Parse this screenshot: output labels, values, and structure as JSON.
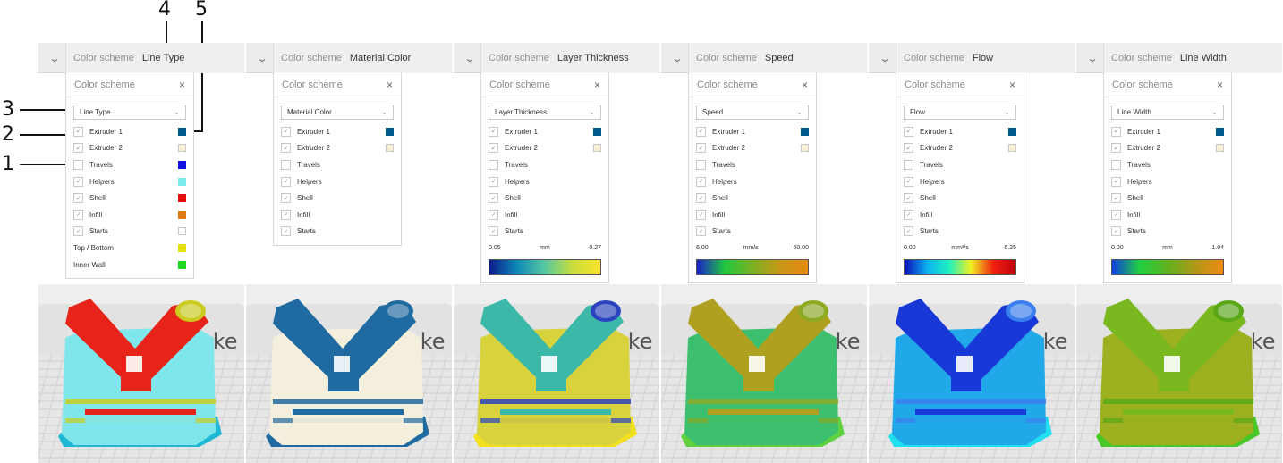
{
  "callouts": [
    {
      "label": "4"
    },
    {
      "label": "5"
    },
    {
      "label": "3"
    },
    {
      "label": "2"
    },
    {
      "label": "1"
    }
  ],
  "panels": [
    {
      "bar_label": "Color scheme",
      "bar_value": "Line Type",
      "box_title": "Color scheme",
      "close": "×",
      "select": "Line Type",
      "rows": [
        {
          "label": "Extruder 1",
          "checked": true,
          "has_box": true,
          "color": "#005b8c"
        },
        {
          "label": "Extruder 2",
          "checked": true,
          "has_box": true,
          "color": "#f6efd4"
        },
        {
          "label": "Travels",
          "checked": false,
          "has_box": true,
          "color": "#1010e0"
        },
        {
          "label": "Helpers",
          "checked": true,
          "has_box": true,
          "color": "#7aecef"
        },
        {
          "label": "Shell",
          "checked": true,
          "has_box": true,
          "color": "#e01010"
        },
        {
          "label": "Infill",
          "checked": true,
          "has_box": true,
          "color": "#e07a10"
        },
        {
          "label": "Starts",
          "checked": true,
          "has_box": true,
          "color": "#ffffff"
        },
        {
          "label": "Top / Bottom",
          "checked": false,
          "has_box": false,
          "color": "#e6e010"
        },
        {
          "label": "Inner Wall",
          "checked": false,
          "has_box": false,
          "color": "#20d820"
        }
      ],
      "legend": null,
      "model": {
        "primary": "#e8231a",
        "secondary": "#7fe6ec",
        "accent": "#cccc20",
        "base": "#21b8d6"
      }
    },
    {
      "bar_label": "Color scheme",
      "bar_value": "Material Color",
      "box_title": "Color scheme",
      "close": "×",
      "select": "Material Color",
      "rows": [
        {
          "label": "Extruder 1",
          "checked": true,
          "has_box": true,
          "color": "#005b8c"
        },
        {
          "label": "Extruder 2",
          "checked": true,
          "has_box": true,
          "color": "#f6efd4"
        },
        {
          "label": "Travels",
          "checked": false,
          "has_box": true,
          "color": null
        },
        {
          "label": "Helpers",
          "checked": true,
          "has_box": true,
          "color": null
        },
        {
          "label": "Shell",
          "checked": true,
          "has_box": true,
          "color": null
        },
        {
          "label": "Infill",
          "checked": true,
          "has_box": true,
          "color": null
        },
        {
          "label": "Starts",
          "checked": true,
          "has_box": true,
          "color": null
        }
      ],
      "legend": null,
      "model": {
        "primary": "#1f6aa0",
        "secondary": "#f4efdc",
        "accent": "#1f6aa0",
        "base": "#1f6aa0"
      }
    },
    {
      "bar_label": "Color scheme",
      "bar_value": "Layer Thickness",
      "box_title": "Color scheme",
      "close": "×",
      "select": "Layer Thickness",
      "rows": [
        {
          "label": "Extruder 1",
          "checked": true,
          "has_box": true,
          "color": "#005b8c"
        },
        {
          "label": "Extruder 2",
          "checked": true,
          "has_box": true,
          "color": "#f6efd4"
        },
        {
          "label": "Travels",
          "checked": false,
          "has_box": true,
          "color": null
        },
        {
          "label": "Helpers",
          "checked": true,
          "has_box": true,
          "color": null
        },
        {
          "label": "Shell",
          "checked": true,
          "has_box": true,
          "color": null
        },
        {
          "label": "Infill",
          "checked": true,
          "has_box": true,
          "color": null
        },
        {
          "label": "Starts",
          "checked": true,
          "has_box": true,
          "color": null
        }
      ],
      "legend": {
        "min": "0.05",
        "unit": "mm",
        "max": "0.27",
        "gradient": [
          "#0c1a8c",
          "#0e8ab8",
          "#57c8a0",
          "#c8de3c",
          "#fde22a"
        ]
      },
      "model": {
        "primary": "#3cb8a8",
        "secondary": "#d8d23c",
        "accent": "#2a44c0",
        "base": "#f0e020"
      }
    },
    {
      "bar_label": "Color scheme",
      "bar_value": "Speed",
      "box_title": "Color scheme",
      "close": "×",
      "select": "Speed",
      "rows": [
        {
          "label": "Extruder 1",
          "checked": true,
          "has_box": true,
          "color": "#005b8c"
        },
        {
          "label": "Extruder 2",
          "checked": true,
          "has_box": true,
          "color": "#f6efd4"
        },
        {
          "label": "Travels",
          "checked": false,
          "has_box": true,
          "color": null
        },
        {
          "label": "Helpers",
          "checked": true,
          "has_box": true,
          "color": null
        },
        {
          "label": "Shell",
          "checked": true,
          "has_box": true,
          "color": null
        },
        {
          "label": "Infill",
          "checked": true,
          "has_box": true,
          "color": null
        },
        {
          "label": "Starts",
          "checked": true,
          "has_box": true,
          "color": null
        }
      ],
      "legend": {
        "min": "6.00",
        "unit": "mm/s",
        "max": "60.00",
        "gradient": [
          "#1a20c8",
          "#20c840",
          "#7ab020",
          "#c89818",
          "#e88a10"
        ]
      },
      "model": {
        "primary": "#b0a020",
        "secondary": "#3cc070",
        "accent": "#8caa22",
        "base": "#60d040"
      }
    },
    {
      "bar_label": "Color scheme",
      "bar_value": "Flow",
      "box_title": "Color scheme",
      "close": "×",
      "select": "Flow",
      "rows": [
        {
          "label": "Extruder 1",
          "checked": true,
          "has_box": true,
          "color": "#005b8c"
        },
        {
          "label": "Extruder 2",
          "checked": true,
          "has_box": true,
          "color": "#f6efd4"
        },
        {
          "label": "Travels",
          "checked": false,
          "has_box": true,
          "color": null
        },
        {
          "label": "Helpers",
          "checked": true,
          "has_box": true,
          "color": null
        },
        {
          "label": "Shell",
          "checked": true,
          "has_box": true,
          "color": null
        },
        {
          "label": "Infill",
          "checked": true,
          "has_box": true,
          "color": null
        },
        {
          "label": "Starts",
          "checked": true,
          "has_box": true,
          "color": null
        }
      ],
      "legend": {
        "min": "0.00",
        "unit": "mm³/s",
        "max": "6.25",
        "gradient": [
          "#0a0ab8",
          "#0ab0f0",
          "#20f0c0",
          "#f0f020",
          "#f02010",
          "#c00010"
        ]
      },
      "model": {
        "primary": "#1838d8",
        "secondary": "#20a8e8",
        "accent": "#3c80f0",
        "base": "#20e0f0"
      }
    },
    {
      "bar_label": "Color scheme",
      "bar_value": "Line Width",
      "box_title": "Color scheme",
      "close": "×",
      "select": "Line Width",
      "rows": [
        {
          "label": "Extruder 1",
          "checked": true,
          "has_box": true,
          "color": "#005b8c"
        },
        {
          "label": "Extruder 2",
          "checked": true,
          "has_box": true,
          "color": "#f6efd4"
        },
        {
          "label": "Travels",
          "checked": false,
          "has_box": true,
          "color": null
        },
        {
          "label": "Helpers",
          "checked": true,
          "has_box": true,
          "color": null
        },
        {
          "label": "Shell",
          "checked": true,
          "has_box": true,
          "color": null
        },
        {
          "label": "Infill",
          "checked": true,
          "has_box": true,
          "color": null
        },
        {
          "label": "Starts",
          "checked": true,
          "has_box": true,
          "color": null
        }
      ],
      "legend": {
        "min": "0.00",
        "unit": "mm",
        "max": "1.04",
        "gradient": [
          "#1040e0",
          "#20d040",
          "#60b020",
          "#b09818",
          "#f08a10"
        ]
      },
      "model": {
        "primary": "#7ab820",
        "secondary": "#9cb020",
        "accent": "#5aa818",
        "base": "#48c828"
      }
    }
  ],
  "watermark": "ake"
}
